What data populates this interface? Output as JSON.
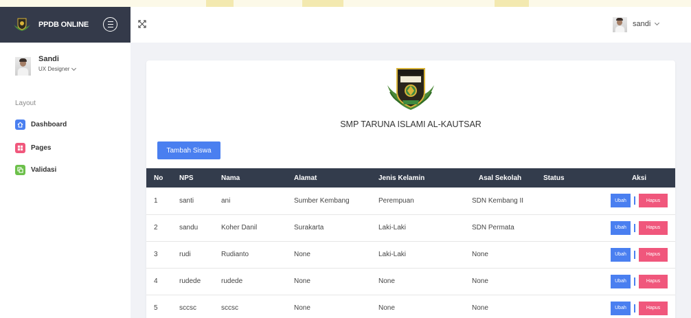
{
  "brand": {
    "name": "PPDB ONLINE",
    "logo_icon": "school-crest-icon"
  },
  "sidebar": {
    "user": {
      "name": "Sandi",
      "role": "UX Designer"
    },
    "section_label": "Layout",
    "items": [
      {
        "label": "Dashboard",
        "icon": "home-icon",
        "color": "#4a7ff0"
      },
      {
        "label": "Pages",
        "icon": "grid-icon",
        "color": "#f0577c"
      },
      {
        "label": "Validasi",
        "icon": "copy-icon",
        "color": "#6cc04a"
      }
    ]
  },
  "header": {
    "username": "sandi"
  },
  "main": {
    "school_name": "SMP TARUNA ISLAMI AL-KAUTSAR",
    "add_button": "Tambah Siswa",
    "columns": [
      "No",
      "NPS",
      "Nama",
      "Alamat",
      "Jenis Kelamin",
      "Asal Sekolah",
      "Status",
      "Aksi"
    ],
    "rows": [
      {
        "no": "1",
        "nps": "santi",
        "nama": "ani",
        "alamat": "Sumber Kembang",
        "jk": "Perempuan",
        "asal": "SDN Kembang II",
        "status": ""
      },
      {
        "no": "2",
        "nps": "sandu",
        "nama": "Koher Danil",
        "alamat": "Surakarta",
        "jk": "Laki-Laki",
        "asal": "SDN Permata",
        "status": ""
      },
      {
        "no": "3",
        "nps": "rudi",
        "nama": "Rudianto",
        "alamat": "None",
        "jk": "Laki-Laki",
        "asal": "None",
        "status": ""
      },
      {
        "no": "4",
        "nps": "rudede",
        "nama": "rudede",
        "alamat": "None",
        "jk": "None",
        "asal": "None",
        "status": ""
      },
      {
        "no": "5",
        "nps": "sccsc",
        "nama": "sccsc",
        "alamat": "None",
        "jk": "None",
        "asal": "None",
        "status": ""
      }
    ],
    "edit_label": "Ubah",
    "delete_label": "Hapus"
  },
  "colors": {
    "primary": "#4a7ff0",
    "danger": "#f0577c",
    "success": "#6cc04a",
    "dark": "#343a4a"
  }
}
